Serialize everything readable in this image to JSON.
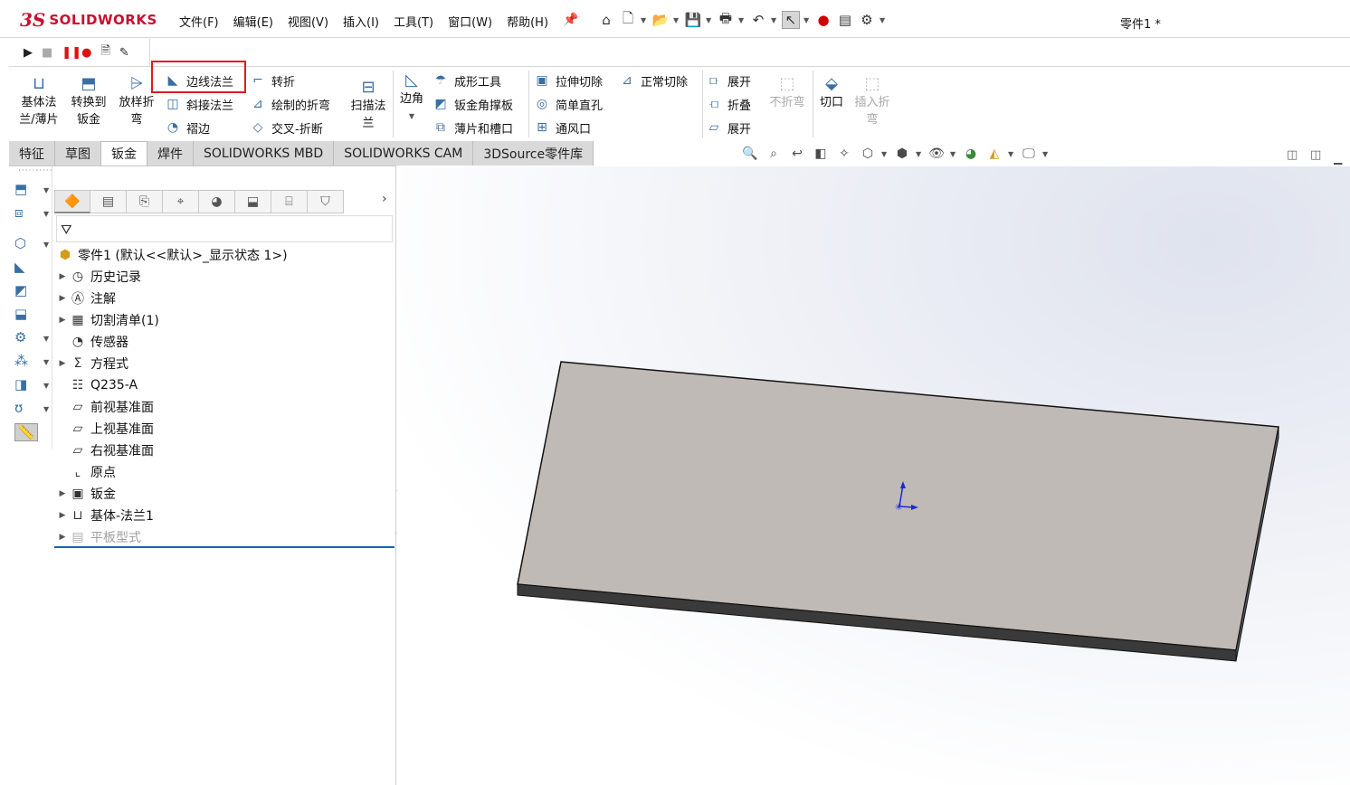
{
  "app": {
    "logo_ds": "3S",
    "logo_text": "SOLIDWORKS",
    "document_title": "零件1 *"
  },
  "menu": [
    "文件(F)",
    "编辑(E)",
    "视图(V)",
    "插入(I)",
    "工具(T)",
    "窗口(W)",
    "帮助(H)"
  ],
  "ribbon": {
    "base_flange": [
      "基体法",
      "兰/薄片"
    ],
    "convert": [
      "转换到",
      "钣金"
    ],
    "lofted_bend": [
      "放样折",
      "弯"
    ],
    "edge_flange": "边线法兰",
    "miter_flange": "斜接法兰",
    "hem": "褶边",
    "jog": "转折",
    "sketched_bend": "绘制的折弯",
    "cross_break": "交叉-折断",
    "swept_flange": [
      "扫描法",
      "兰"
    ],
    "corner": "边角",
    "forming_tool": "成形工具",
    "gusset": "钣金角撑板",
    "tab_slot": "薄片和槽口",
    "extruded_cut": "拉伸切除",
    "simple_hole": "简单直孔",
    "vent": "通风口",
    "normal_cut": "正常切除",
    "unfold": "展开",
    "fold": "折叠",
    "flatten": "展开",
    "no_bends": "不折弯",
    "rip": "切口",
    "insert_bends": [
      "插入折",
      "弯"
    ]
  },
  "tabs": [
    "特征",
    "草图",
    "钣金",
    "焊件",
    "SOLIDWORKS MBD",
    "SOLIDWORKS CAM",
    "3DSource零件库"
  ],
  "active_tab": "钣金",
  "tree": {
    "root": "零件1  (默认<<默认>_显示状态 1>)",
    "items": [
      {
        "label": "历史记录",
        "icon": "history-icon",
        "expandable": true
      },
      {
        "label": "注解",
        "icon": "annotation-icon",
        "expandable": true
      },
      {
        "label": "切割清单(1)",
        "icon": "cutlist-icon",
        "expandable": true
      },
      {
        "label": "传感器",
        "icon": "sensor-icon",
        "expandable": false
      },
      {
        "label": "方程式",
        "icon": "equation-icon",
        "expandable": true
      },
      {
        "label": "Q235-A",
        "icon": "material-icon",
        "expandable": false
      },
      {
        "label": "前视基准面",
        "icon": "plane-icon",
        "expandable": false
      },
      {
        "label": "上视基准面",
        "icon": "plane-icon",
        "expandable": false
      },
      {
        "label": "右视基准面",
        "icon": "plane-icon",
        "expandable": false
      },
      {
        "label": "原点",
        "icon": "origin-icon",
        "expandable": false
      },
      {
        "label": "钣金",
        "icon": "sheetmetal-icon",
        "expandable": true
      },
      {
        "label": "基体-法兰1",
        "icon": "base-flange-icon",
        "expandable": true
      },
      {
        "label": "平板型式",
        "icon": "flat-pattern-icon",
        "expandable": true,
        "suppressed": true
      }
    ]
  },
  "colors": {
    "accent_red": "#e0191e",
    "plate_top": "#bfbab6",
    "plate_edge": "#3a3a3a",
    "tree_end_line": "#1e5fb4"
  }
}
